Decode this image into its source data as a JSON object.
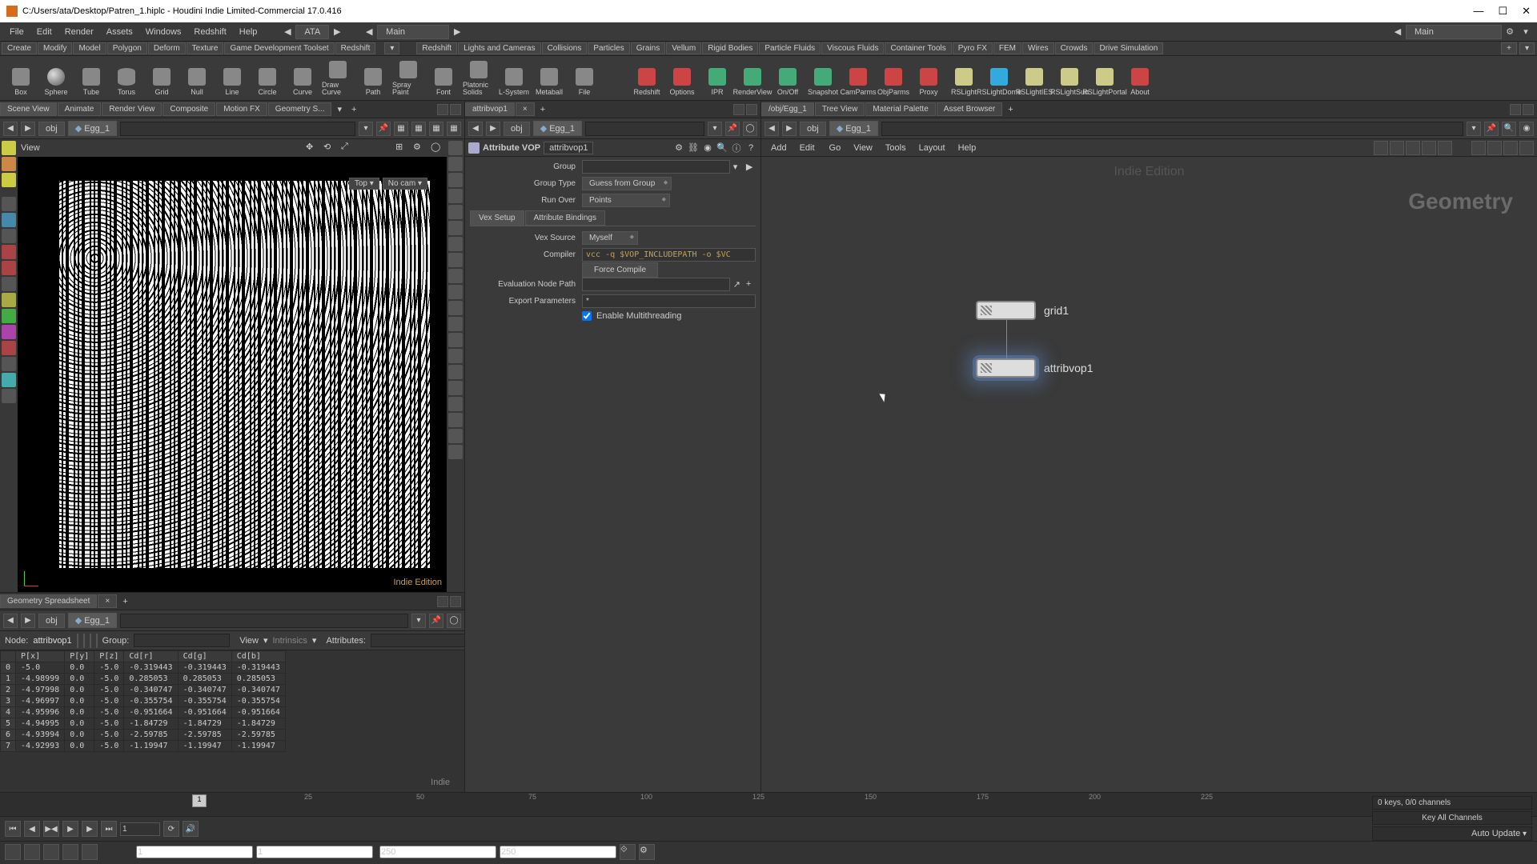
{
  "title": "C:/Users/ata/Desktop/Patren_1.hiplc - Houdini Indie Limited-Commercial 17.0.416",
  "menus": [
    "File",
    "Edit",
    "Render",
    "Assets",
    "Windows",
    "Redshift",
    "Help"
  ],
  "menu_user": "ATA",
  "menu_desktop": "Main",
  "menu_desktop2": "Main",
  "shelves": [
    "Create",
    "Modify",
    "Model",
    "Polygon",
    "Deform",
    "Texture",
    "Game Development Toolset",
    "Redshift"
  ],
  "shelves2": [
    "Redshift",
    "Lights and Cameras",
    "Collisions",
    "Particles",
    "Grains",
    "Vellum",
    "Rigid Bodies",
    "Particle Fluids",
    "Viscous Fluids",
    "Container Tools",
    "Pyro FX",
    "FEM",
    "Wires",
    "Crowds",
    "Drive Simulation"
  ],
  "tools_left": [
    {
      "l": "Box"
    },
    {
      "l": "Sphere"
    },
    {
      "l": "Tube"
    },
    {
      "l": "Torus"
    },
    {
      "l": "Grid"
    },
    {
      "l": "Null"
    },
    {
      "l": "Line"
    },
    {
      "l": "Circle"
    },
    {
      "l": "Curve"
    },
    {
      "l": "Draw Curve"
    },
    {
      "l": "Path"
    },
    {
      "l": "Spray Paint"
    },
    {
      "l": "Font"
    },
    {
      "l": "Platonic Solids"
    },
    {
      "l": "L-System"
    },
    {
      "l": "Metaball"
    },
    {
      "l": "File"
    }
  ],
  "tools_right": [
    {
      "l": "Redshift"
    },
    {
      "l": "Options"
    },
    {
      "l": "IPR"
    },
    {
      "l": "RenderView"
    },
    {
      "l": "On/Off"
    },
    {
      "l": "Snapshot"
    },
    {
      "l": "CamParms"
    },
    {
      "l": "ObjParms"
    },
    {
      "l": "Proxy"
    },
    {
      "l": "RSLight"
    },
    {
      "l": "RSLightDome"
    },
    {
      "l": "RSLightIES"
    },
    {
      "l": "RSLightSun"
    },
    {
      "l": "RSLightPortal"
    },
    {
      "l": "About"
    }
  ],
  "scene_tabs": [
    "Scene View",
    "Animate",
    "Render View",
    "Composite",
    "Motion FX",
    "Geometry S..."
  ],
  "spread_tab": "Geometry Spreadsheet",
  "parm_tab": "attribvop1",
  "net_tabs": [
    "/obj/Egg_1",
    "Tree View",
    "Material Palette",
    "Asset Browser"
  ],
  "path_obj": "obj",
  "path_geo": "Egg_1",
  "view_label": "View",
  "cam_top": "Top ▾",
  "cam_nocam": "No cam ▾",
  "indie": "Indie Edition",
  "nodetype": "Attribute VOP",
  "nodename": "attribvop1",
  "parm": {
    "group_lbl": "Group",
    "grouptype_lbl": "Group Type",
    "grouptype_val": "Guess from Group",
    "runover_lbl": "Run Over",
    "runover_val": "Points",
    "tab1": "Vex Setup",
    "tab2": "Attribute Bindings",
    "vexsrc_lbl": "Vex Source",
    "vexsrc_val": "Myself",
    "compiler_lbl": "Compiler",
    "compiler_val": "vcc -q $VOP_INCLUDEPATH -o $VC",
    "force": "Force Compile",
    "evalpath_lbl": "Evaluation Node Path",
    "export_lbl": "Export Parameters",
    "export_val": "*",
    "multi_lbl": "Enable Multithreading"
  },
  "netmenu": [
    "Go",
    "View",
    "Tools",
    "Layout",
    "Help"
  ],
  "netmenu_pre": [
    "Add",
    "Edit"
  ],
  "geometry_wm": "Geometry",
  "nodes": {
    "grid": "grid1",
    "attrib": "attribvop1"
  },
  "spread": {
    "node_lbl": "Node:",
    "node": "attribvop1",
    "group_lbl": "Group:",
    "view_lbl": "View",
    "intrinsics": "Intrinsics",
    "attrs": "Attributes:",
    "headers": [
      "",
      "P[x]",
      "P[y]",
      "P[z]",
      "Cd[r]",
      "Cd[g]",
      "Cd[b]"
    ],
    "rows": [
      [
        "0",
        "-5.0",
        "0.0",
        "-5.0",
        "-0.319443",
        "-0.319443",
        "-0.319443"
      ],
      [
        "1",
        "-4.98999",
        "0.0",
        "-5.0",
        "0.285053",
        "0.285053",
        "0.285053"
      ],
      [
        "2",
        "-4.97998",
        "0.0",
        "-5.0",
        "-0.340747",
        "-0.340747",
        "-0.340747"
      ],
      [
        "3",
        "-4.96997",
        "0.0",
        "-5.0",
        "-0.355754",
        "-0.355754",
        "-0.355754"
      ],
      [
        "4",
        "-4.95996",
        "0.0",
        "-5.0",
        "-0.951664",
        "-0.951664",
        "-0.951664"
      ],
      [
        "5",
        "-4.94995",
        "0.0",
        "-5.0",
        "-1.84729",
        "-1.84729",
        "-1.84729"
      ],
      [
        "6",
        "-4.93994",
        "0.0",
        "-5.0",
        "-2.59785",
        "-2.59785",
        "-2.59785"
      ],
      [
        "7",
        "-4.92993",
        "0.0",
        "-5.0",
        "-1.19947",
        "-1.19947",
        "-1.19947"
      ]
    ],
    "indie": "Indie"
  },
  "timeline": {
    "ticks": [
      25,
      50,
      75,
      100,
      125,
      150,
      175,
      200,
      225
    ],
    "frame": "1",
    "start": "1",
    "end": "1",
    "rstart": "250",
    "rend": "250",
    "keys": "0 keys, 0/0 channels",
    "keyall": "Key All Channels",
    "auto": "Auto Update"
  }
}
